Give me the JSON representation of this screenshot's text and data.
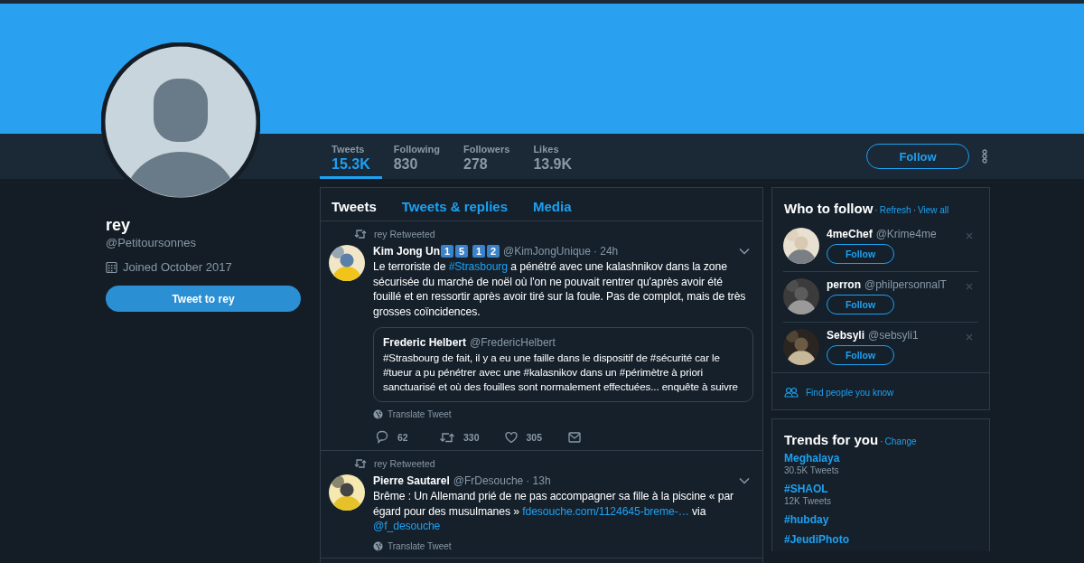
{
  "profile": {
    "name": "rey",
    "handle": "@Petitoursonnes",
    "joined": "Joined October 2017",
    "tweet_button": "Tweet to rey"
  },
  "stats": [
    {
      "label": "Tweets",
      "value": "15.3K",
      "selected": true
    },
    {
      "label": "Following",
      "value": "830",
      "selected": false
    },
    {
      "label": "Followers",
      "value": "278",
      "selected": false
    },
    {
      "label": "Likes",
      "value": "13.9K",
      "selected": false
    }
  ],
  "follow_button": "Follow",
  "timeline_tabs": [
    {
      "label": "Tweets",
      "selected": true
    },
    {
      "label": "Tweets & replies",
      "selected": false
    },
    {
      "label": "Media",
      "selected": false
    }
  ],
  "tweets": [
    {
      "retweeted_by": "rey Retweeted",
      "name": "Kim Jong Un",
      "keycap_groups": [
        [
          "1",
          "5"
        ],
        [
          "1",
          "2"
        ]
      ],
      "handle": "@KimJongUnique",
      "time": "· 24h",
      "text": [
        {
          "kind": "plain",
          "text": "Le terroriste de "
        },
        {
          "kind": "link",
          "text": "#Strasbourg"
        },
        {
          "kind": "plain",
          "text": " a pénétré avec une kalashnikov dans la zone sécurisée du marché de noël où l'on ne pouvait rentrer qu'après avoir été fouillé et en ressortir après avoir tiré sur la foule. Pas de complot, mais de très grosses coïncidences."
        }
      ],
      "quote": {
        "name": "Frederic Helbert",
        "handle": "@FredericHelbert",
        "text": "#Strasbourg de fait, il y a eu une faille dans le dispositif de #sécurité car le #tueur a pu pénétrer avec une #kalasnikov dans un #périmètre à priori sanctuarisé et où des fouilles sont normalement effectuées... enquête à suivre"
      },
      "translate": "Translate Tweet",
      "replies": "62",
      "retweets": "330",
      "likes": "305"
    },
    {
      "retweeted_by": "rey Retweeted",
      "name": "Pierre Sautarel",
      "handle": "@FrDesouche",
      "time": "· 13h",
      "text": [
        {
          "kind": "plain",
          "text": "Brême : Un Allemand prié de ne pas accompagner sa fille à la piscine « par égard pour des musulmanes » "
        },
        {
          "kind": "link",
          "text": "fdesouche.com/1124645-breme-…"
        },
        {
          "kind": "plain",
          "text": " via "
        },
        {
          "kind": "link",
          "text": "@f_desouche"
        }
      ],
      "translate": "Translate Tweet"
    }
  ],
  "who_to_follow": {
    "title": "Who to follow",
    "separator": "·",
    "refresh": "Refresh",
    "view_all": "View all",
    "users": [
      {
        "name": "4meChef",
        "handle": "@Krime4me",
        "button": "Follow"
      },
      {
        "name": "perron",
        "handle": "@philpersonnalT",
        "button": "Follow"
      },
      {
        "name": "Sebsyli",
        "handle": "@sebsyli1",
        "button": "Follow"
      }
    ],
    "find_people": "Find people you know"
  },
  "trends": {
    "title": "Trends for you",
    "separator": "·",
    "change": "Change",
    "items": [
      {
        "name": "Meghalaya",
        "count": "30.5K Tweets"
      },
      {
        "name": "#SHAOL",
        "count": "12K Tweets"
      },
      {
        "name": "#hubday"
      },
      {
        "name": "#JeudiPhoto"
      }
    ]
  }
}
